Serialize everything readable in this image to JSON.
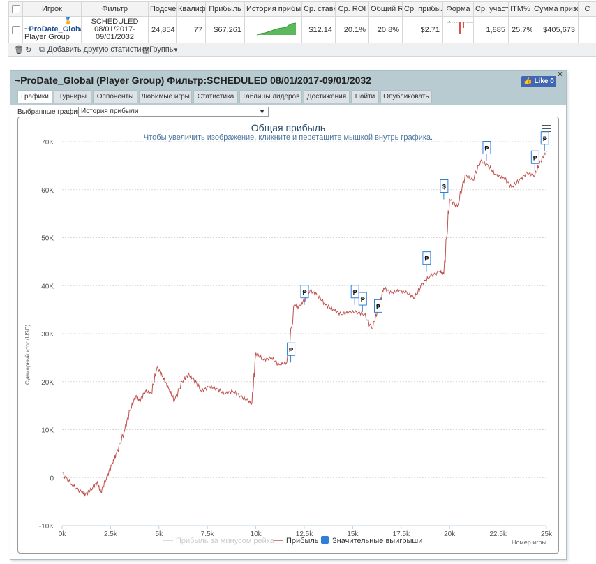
{
  "stats_table": {
    "headers": [
      "Игрок",
      "Фильтр",
      "Подсчет",
      "Квалифи",
      "Прибыль",
      "История прибыли",
      "Ср. ставка",
      "Ср. ROI",
      "Общий RO",
      "Ср. прибыль",
      "Форма",
      "Ср. участ",
      "ITM%",
      "Сумма призов",
      "С"
    ],
    "row": {
      "player": "~ProDate_Globa",
      "player_group": "Player Group",
      "filter_line1": "SCHEDULED",
      "filter_line2": "08/01/2017-",
      "filter_line3": "09/01/2032",
      "count": "24,854",
      "qualified": "77",
      "profit": "$67,261",
      "avg_stake": "$12.14",
      "avg_roi": "20.1%",
      "total_roi": "20.8%",
      "avg_profit": "$2.71",
      "avg_entrants": "1,885",
      "itm": "25.7%",
      "prize_sum": "$405,673"
    }
  },
  "toolbar": {
    "add_stat": "Добавить другую статистику",
    "groups": "Группы"
  },
  "panel": {
    "title": "~ProDate_Global (Player Group) Фильтр:SCHEDULED 08/01/2017-09/01/2032",
    "like_label": "Like 0",
    "close_label": "×",
    "tabs": [
      "Графики",
      "Турниры",
      "Оппоненты",
      "Любимые игры",
      "Статистика",
      "Таблицы лидеров",
      "Достижения",
      "Найти",
      "Опубликовать"
    ],
    "selected_charts_label": "Выбранные графики:",
    "selected_chart_value": "История прибыли"
  },
  "chart_data": {
    "type": "line",
    "title": "Общая прибыль",
    "subtitle": "Чтобы увеличить изображение, кликните и перетащите мышкой внутрь графика.",
    "ylabel": "Суммарный итог (USD)",
    "xlabel": "Номер игры",
    "x_ticks": [
      "0k",
      "2.5k",
      "5k",
      "7.5k",
      "10k",
      "12.5k",
      "15k",
      "17.5k",
      "20k",
      "22.5k",
      "25k"
    ],
    "y_ticks": [
      "-10K",
      "0",
      "10K",
      "20K",
      "30K",
      "40K",
      "50K",
      "60K",
      "70K"
    ],
    "xlim": [
      0,
      25000
    ],
    "ylim": [
      -10000,
      70000
    ],
    "grid": true,
    "legend_position": "bottom",
    "legend": [
      "Прибыль за минусом рейка",
      "Прибыль",
      "Значительные выигрыши"
    ],
    "series": [
      {
        "name": "Прибыль",
        "color": "#c0504d",
        "x": [
          0,
          500,
          1000,
          1200,
          1500,
          1800,
          2000,
          2300,
          2600,
          2800,
          3200,
          3500,
          3800,
          4000,
          4300,
          4600,
          4900,
          5200,
          5500,
          5800,
          6200,
          6500,
          6800,
          7200,
          7600,
          8000,
          8400,
          8800,
          9200,
          9600,
          9800,
          10000,
          10400,
          10800,
          11200,
          11600,
          12000,
          12200,
          12500,
          12800,
          13200,
          13600,
          14000,
          14400,
          14800,
          15200,
          15600,
          16000,
          16300,
          16600,
          17000,
          17400,
          17800,
          18200,
          18600,
          19000,
          19500,
          19700,
          20000,
          20400,
          20800,
          21200,
          21600,
          22000,
          22400,
          22800,
          23200,
          23600,
          24000,
          24400,
          24700,
          25000
        ],
        "y": [
          1000,
          -1500,
          -3000,
          -3500,
          -2500,
          -1000,
          -3000,
          0,
          3000,
          5000,
          9500,
          14000,
          17000,
          16000,
          18000,
          17500,
          23000,
          21000,
          18500,
          16000,
          20000,
          21500,
          20500,
          18000,
          19000,
          18500,
          17500,
          18000,
          17000,
          16000,
          15500,
          26000,
          24500,
          25000,
          23500,
          24000,
          36000,
          35500,
          37000,
          39000,
          38000,
          36000,
          35000,
          34000,
          34500,
          34500,
          34000,
          31000,
          35000,
          39500,
          38500,
          39000,
          38500,
          37500,
          40500,
          42000,
          43000,
          42500,
          58000,
          56500,
          63000,
          62000,
          66000,
          65000,
          63000,
          62500,
          60500,
          62000,
          63500,
          63000,
          66000,
          68000
        ]
      },
      {
        "name": "Значительные выигрыши",
        "color": "#2f7ed8",
        "x": [
          11800,
          12500,
          15100,
          15500,
          16300,
          18800,
          19700,
          21900,
          24400,
          24900
        ],
        "y": [
          24000,
          36000,
          36000,
          34500,
          33000,
          43000,
          58000,
          66000,
          64000,
          68000
        ]
      }
    ]
  }
}
